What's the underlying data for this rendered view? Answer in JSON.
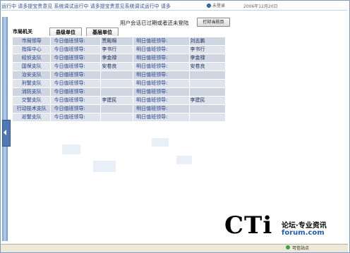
{
  "marquee_text": "运行中  请多提宝贵意见  系统调试运行中  请多提宝贵意见系统调试运行中  请多",
  "user_status": "未登录",
  "date": "2006年12月20日",
  "session_message": "用户会话已过期或者还未登陆",
  "print_button": "打印当前页",
  "tabs": [
    "市局机关",
    "县级单位",
    "基层单位"
  ],
  "rows": [
    {
      "unit": "市局领导",
      "today_label": "今日值班领导:",
      "today": "贾殿棉",
      "tomorrow_label": "明日值班领导:",
      "tomorrow": "刘志鹏"
    },
    {
      "unit": "指挥中心",
      "today_label": "今日值班领导:",
      "today": "李书行",
      "tomorrow_label": "明日值班领导:",
      "tomorrow": "李书行"
    },
    {
      "unit": "经侦支队",
      "today_label": "今日值班领导:",
      "today": "李金禄",
      "tomorrow_label": "明日值班领导:",
      "tomorrow": "李金禄"
    },
    {
      "unit": "国保支队",
      "today_label": "今日值班领导:",
      "today": "安卷良",
      "tomorrow_label": "明日值班领导:",
      "tomorrow": "安卷良"
    },
    {
      "unit": "治安支队",
      "today_label": "今日值班领导:",
      "today": "",
      "tomorrow_label": "明日值班领导:",
      "tomorrow": ""
    },
    {
      "unit": "刑警支队",
      "today_label": "今日值班领导:",
      "today": "",
      "tomorrow_label": "明日值班领导:",
      "tomorrow": ""
    },
    {
      "unit": "消防支队",
      "today_label": "今日值班领导:",
      "today": "",
      "tomorrow_label": "明日值班领导:",
      "tomorrow": ""
    },
    {
      "unit": "交警支队",
      "today_label": "今日值班领导:",
      "today": "李建民",
      "tomorrow_label": "明日值班领导:",
      "tomorrow": "李建民"
    },
    {
      "unit": "行动技术支队",
      "today_label": "今日值班领导:",
      "today": "",
      "tomorrow_label": "明日值班领导:",
      "tomorrow": ""
    },
    {
      "unit": "巡警支队",
      "today_label": "今日值班领导:",
      "today": "",
      "tomorrow_label": "明日值班领导:",
      "tomorrow": ""
    }
  ],
  "watermark": {
    "logo": "CTi",
    "line1": "论坛·专业资讯",
    "line2": "forum.com"
  },
  "status_bar": {
    "zone": "可信站点"
  }
}
